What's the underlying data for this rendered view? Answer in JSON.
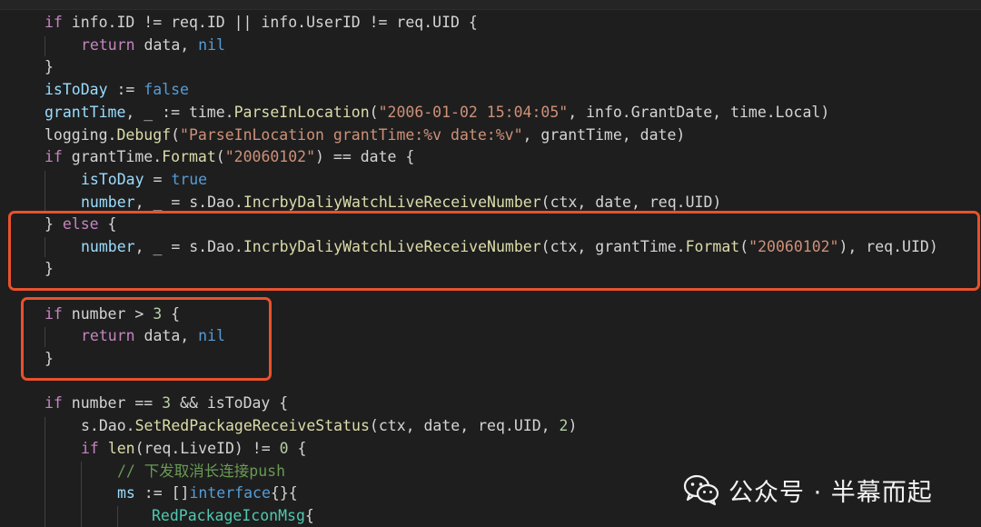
{
  "code": {
    "line1": {
      "kw_if": "if",
      "a": " info.ID != req.ID || info.UserID != req.UID {"
    },
    "line2": {
      "kw_return": "return",
      "a": " data, ",
      "nil": "nil"
    },
    "line3": {
      "a": "}"
    },
    "line4": {
      "id": "isToDay",
      "a": " := ",
      "bool": "false"
    },
    "line5": {
      "id": "grantTime",
      "a": ", _ := time.",
      "fn": "ParseInLocation",
      "b": "(",
      "str": "\"2006-01-02 15:04:05\"",
      "c": ", info.GrantDate, time.Local)"
    },
    "line6": {
      "a": "logging.",
      "fn": "Debugf",
      "b": "(",
      "str": "\"ParseInLocation grantTime:%v date:%v\"",
      "c": ", grantTime, date)"
    },
    "line7": {
      "kw_if": "if",
      "a": " grantTime.",
      "fn": "Format",
      "b": "(",
      "str": "\"20060102\"",
      "c": ") == date {"
    },
    "line8": {
      "id": "isToDay",
      "a": " = ",
      "bool": "true"
    },
    "line9": {
      "id": "number",
      "a": ", _ = s.Dao.",
      "fn": "IncrbyDaliyWatchLiveReceiveNumber",
      "b": "(ctx, date, req.UID)"
    },
    "line10": {
      "a": "} ",
      "kw_else": "else",
      "b": " {"
    },
    "line11": {
      "id": "number",
      "a": ", _ = s.Dao.",
      "fn": "IncrbyDaliyWatchLiveReceiveNumber",
      "b": "(ctx, grantTime.",
      "fn2": "Format",
      "c": "(",
      "str": "\"20060102\"",
      "d": "), req.UID)"
    },
    "line12": {
      "a": "}"
    },
    "line14": {
      "kw_if": "if",
      "a": " number > ",
      "num": "3",
      "b": " {"
    },
    "line15": {
      "kw_return": "return",
      "a": " data, ",
      "nil": "nil"
    },
    "line16": {
      "a": "}"
    },
    "line18": {
      "kw_if": "if",
      "a": " number == ",
      "num": "3",
      "b": " && isToDay {"
    },
    "line19": {
      "a": "s.Dao.",
      "fn": "SetRedPackageReceiveStatus",
      "b": "(ctx, date, req.UID, ",
      "num": "2",
      "c": ")"
    },
    "line20": {
      "kw_if": "if",
      "a": " ",
      "fn": "len",
      "b": "(req.LiveID) != ",
      "num": "0",
      "c": " {"
    },
    "line21": {
      "cmt": "// 下发取消长连接push"
    },
    "line22": {
      "id": "ms",
      "a": " := []",
      "bool": "interface",
      "b": "{}{"
    },
    "line23": {
      "ty": "RedPackageIconMsg",
      "a": "{"
    }
  },
  "watermark": {
    "text": "公众号 · 半幕而起",
    "icon": "wechat-icon"
  },
  "colors": {
    "background": "#1e1e1e",
    "highlight_border": "#e8522c",
    "keyword": "#c586c0",
    "constant": "#569cd6",
    "variable": "#9cdcfe",
    "function": "#dcdcaa",
    "string": "#ce9178",
    "number": "#b5cea8",
    "comment": "#6a9955"
  }
}
